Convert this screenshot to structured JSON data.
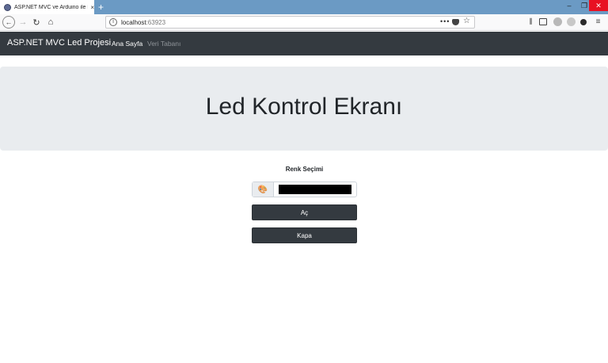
{
  "browser": {
    "tab_title": "ASP.NET MVC ve Arduino ile R",
    "tab_close": "×",
    "new_tab": "+",
    "url_host": "localhost",
    "url_port": ":63923",
    "url_actions": "•••",
    "window_controls": {
      "minimize": "–",
      "maximize": "❐",
      "close": "✕"
    },
    "icons": {
      "back": "arrow-left-icon",
      "forward": "arrow-right-icon",
      "reload": "reload-icon",
      "home": "home-icon",
      "info": "info-icon",
      "pocket": "pocket-icon",
      "bookmark": "star-icon",
      "library": "library-icon",
      "sidebar": "sidebar-icon",
      "menu": "hamburger-menu-icon"
    }
  },
  "site": {
    "brand": "ASP.NET MVC Led Projesi",
    "nav": {
      "home": "Ana Sayfa",
      "database": "Veri Tabanı"
    }
  },
  "jumbotron": {
    "title": "Led Kontrol Ekranı"
  },
  "form": {
    "color_label": "Renk Seçimi",
    "selected_color": "#000000",
    "on_button": "Aç",
    "off_button": "Kapa"
  },
  "colors": {
    "tabstrip": "#6b9ac4",
    "navbar": "#343a40",
    "jumbotron": "#e9ecef",
    "button": "#343a40"
  }
}
